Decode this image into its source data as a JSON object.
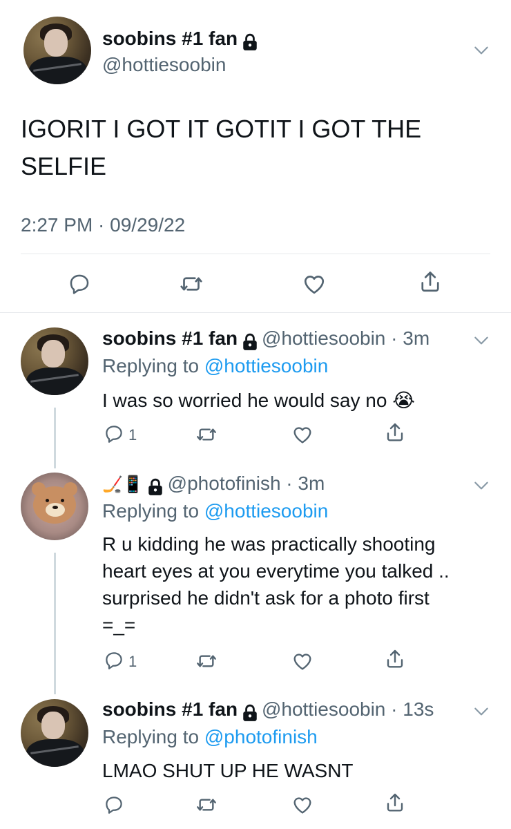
{
  "main_tweet": {
    "name": "soobins #1 fan",
    "handle": "@hottiesoobin",
    "text_line1": "IGORIT I GOT IT GOTIT I GOT THE",
    "text_line2": "SELFIE",
    "timestamp": "2:27 PM · 09/29/22"
  },
  "replies": [
    {
      "name": "soobins #1 fan",
      "handle_time": "@hottiesoobin · 3m",
      "replying_prefix": "Replying to",
      "replying_to": "@hottiesoobin",
      "text": "I was so worried he would say no 😭",
      "reply_count": "1"
    },
    {
      "name_emoji": "🏒📱",
      "handle_time": "@photofinish · 3m",
      "replying_prefix": "Replying to",
      "replying_to": "@hottiesoobin",
      "lines": [
        "R u kidding he was practically shooting",
        "heart eyes at you everytime you talked ..",
        "surprised he didn't ask for a photo first",
        "=_="
      ],
      "reply_count": "1"
    },
    {
      "name": "soobins #1 fan",
      "handle_time": "@hottiesoobin · 13s",
      "replying_prefix": "Replying to",
      "replying_to": "@photofinish",
      "text": "LMAO SHUT UP HE WASNT"
    }
  ]
}
